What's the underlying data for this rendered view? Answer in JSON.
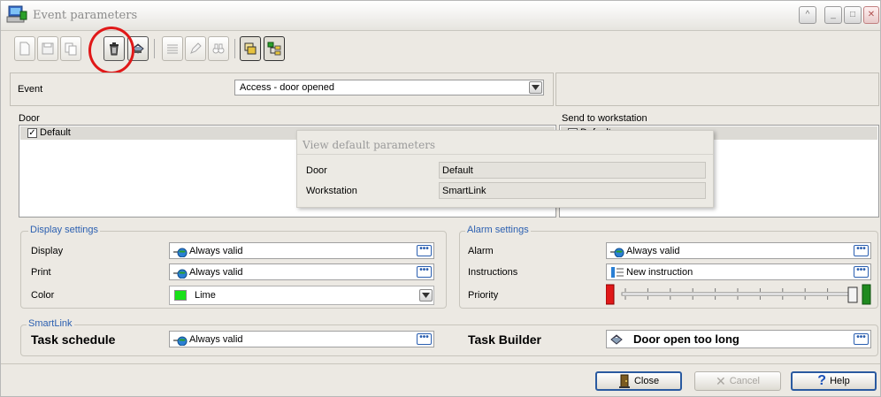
{
  "window": {
    "title": "Event parameters"
  },
  "event": {
    "label": "Event",
    "value": "Access - door opened"
  },
  "door": {
    "label": "Door",
    "items": [
      {
        "label": "Default",
        "checked": true
      }
    ]
  },
  "send_to_workstation": {
    "label": "Send to workstation",
    "items": [
      {
        "label": "Default",
        "checked": false
      }
    ]
  },
  "popup": {
    "title": "View default parameters",
    "rows": [
      {
        "label": "Door",
        "value": "Default"
      },
      {
        "label": "Workstation",
        "value": "SmartLink"
      }
    ]
  },
  "display_settings": {
    "title": "Display settings",
    "display": {
      "label": "Display",
      "value": "Always valid"
    },
    "print": {
      "label": "Print",
      "value": "Always valid"
    },
    "color": {
      "label": "Color",
      "value": "Lime",
      "swatch": "#19e119"
    }
  },
  "alarm_settings": {
    "title": "Alarm settings",
    "alarm": {
      "label": "Alarm",
      "value": "Always valid"
    },
    "instructions": {
      "label": "Instructions",
      "value": "New instruction"
    },
    "priority": {
      "label": "Priority",
      "level": 1.0,
      "low_color": "#e01818",
      "high_color": "#1f8a1f"
    }
  },
  "smartlink": {
    "title": "SmartLink",
    "task_schedule": {
      "label": "Task schedule",
      "value": "Always valid"
    },
    "task_builder": {
      "label": "Task Builder",
      "value": "Door open too long"
    }
  },
  "buttons": {
    "close": "Close",
    "cancel": "Cancel",
    "help": "Help"
  },
  "ellipsis": "•••",
  "colors": {
    "accent": "#2b5fb0",
    "highlight": "#e01818"
  }
}
